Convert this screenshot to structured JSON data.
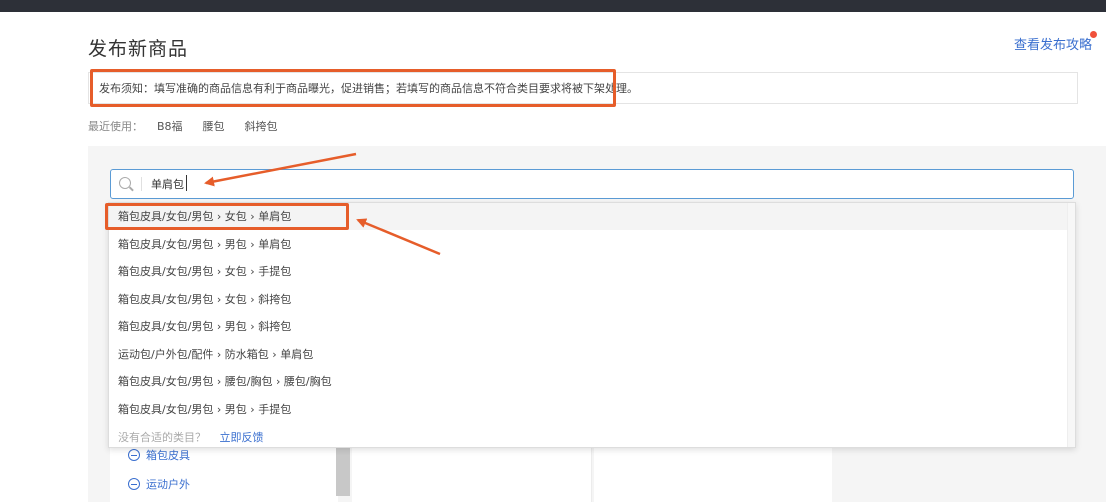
{
  "page": {
    "title": "发布新商品",
    "guide_link": "查看发布攻略"
  },
  "notice": {
    "text": "发布须知：填写准确的商品信息有利于商品曝光，促进销售；若填写的商品信息不符合类目要求将被下架处理。"
  },
  "recent": {
    "label": "最近使用：",
    "items": [
      "B8福",
      "腰包",
      "斜挎包"
    ]
  },
  "search": {
    "value": "单肩包"
  },
  "suggestions": [
    "箱包皮具/女包/男包 › 女包 › 单肩包",
    "箱包皮具/女包/男包 › 男包 › 单肩包",
    "箱包皮具/女包/男包 › 女包 › 手提包",
    "箱包皮具/女包/男包 › 女包 › 斜挎包",
    "箱包皮具/女包/男包 › 男包 › 斜挎包",
    "运动包/户外包/配件 › 防水箱包 › 单肩包",
    "箱包皮具/女包/男包 › 腰包/胸包 › 腰包/胸包",
    "箱包皮具/女包/男包 › 男包 › 手提包"
  ],
  "dropdown_footer": {
    "question": "没有合适的类目？",
    "action": "立即反馈"
  },
  "categories": [
    "箱包皮具",
    "运动户外"
  ],
  "colors": {
    "accent": "#3a6fcf",
    "annotation": "#e65d2a",
    "topbar": "#2d3038"
  }
}
